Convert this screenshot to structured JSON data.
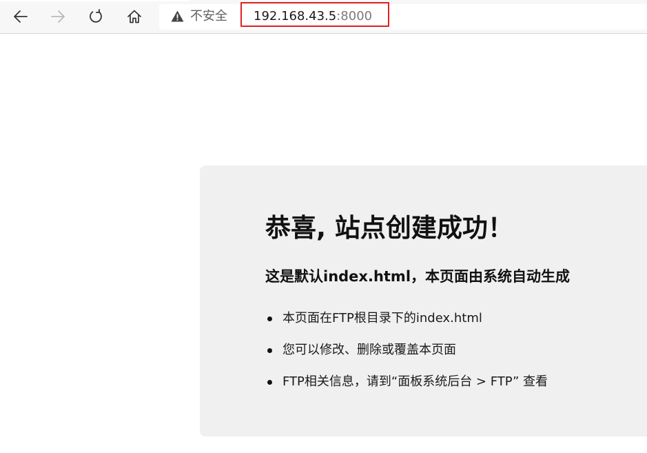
{
  "browser": {
    "security_label": "不安全",
    "url": {
      "host": "192.168.43.5",
      "port": ":8000"
    },
    "highlight_color": "#e0201e",
    "icons": [
      "back-arrow-icon",
      "forward-arrow-icon",
      "refresh-icon",
      "home-icon",
      "warning-icon"
    ]
  },
  "page": {
    "heading": "恭喜, 站点创建成功！",
    "subheading": "这是默认index.html，本页面由系统自动生成",
    "items": [
      "本页面在FTP根目录下的index.html",
      "您可以修改、删除或覆盖本页面",
      "FTP相关信息，请到“面板系统后台 > FTP” 查看"
    ],
    "card_color": "#f0f0f0"
  }
}
